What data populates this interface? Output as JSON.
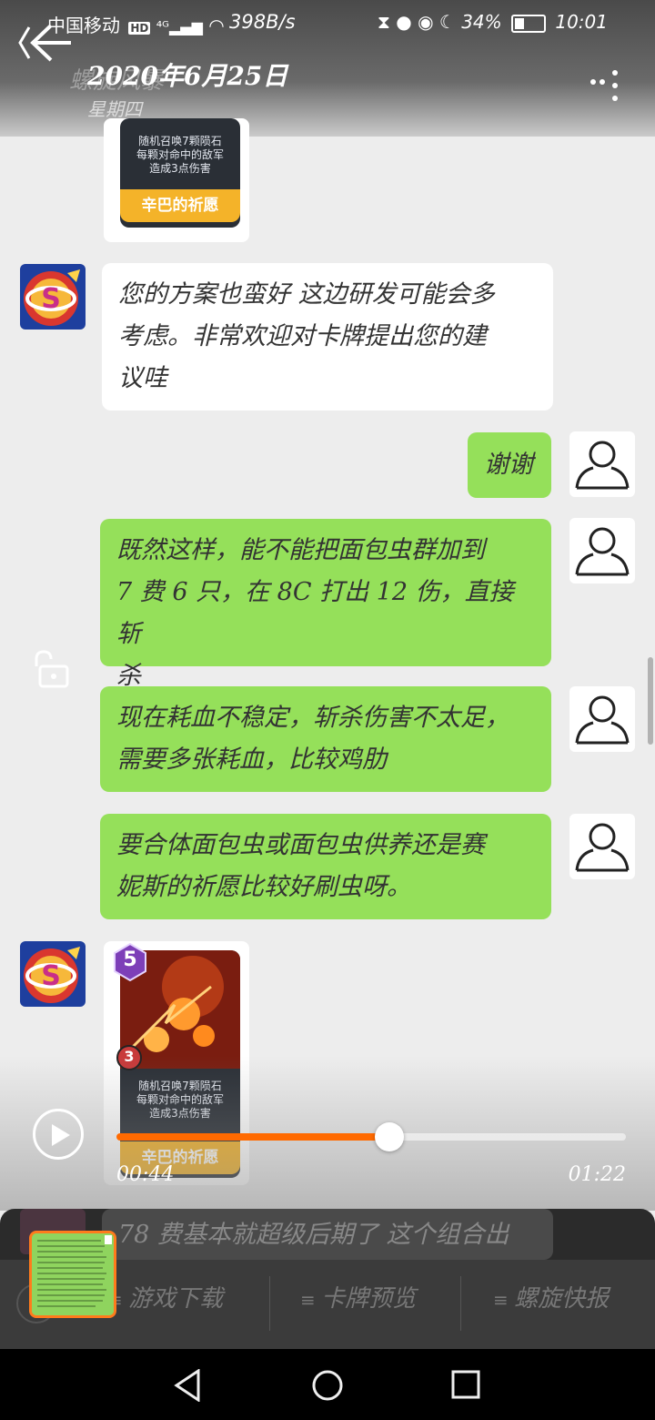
{
  "status_bar": {
    "carrier": "中国移动",
    "hd_badge": "HD",
    "net_speed": "398B/s",
    "battery": "34%",
    "time": "10:01"
  },
  "header": {
    "title": "2020年6月25日",
    "title_faded": "螺旋风暴",
    "subtitle": "星期四"
  },
  "card": {
    "cost": "5",
    "attack": "3",
    "description_lines": [
      "随机召唤7颗陨石",
      "每颗对命中的敌军",
      "造成3点伤害"
    ],
    "name": "辛巴的祈愿"
  },
  "messages": [
    {
      "side": "left",
      "text_lines": [
        "您的方案也蛮好 这边研发可能会多",
        "考虑。非常欢迎对卡牌提出您的建",
        "议哇"
      ]
    },
    {
      "side": "right",
      "text_lines": [
        "谢谢"
      ]
    },
    {
      "side": "right",
      "text_lines": [
        "既然这样，能不能把面包虫群加到",
        "7 费 6 只，在 8C 打出 12 伤，直接斩",
        "杀"
      ]
    },
    {
      "side": "right",
      "text_lines": [
        "现在耗血不稳定，斩杀伤害不太足，",
        "需要多张耗血，比较鸡肋"
      ]
    },
    {
      "side": "right",
      "text_lines": [
        "要合体面包虫或面包虫供养还是赛",
        "妮斯的祈愿比较好刷虫呀。"
      ]
    },
    {
      "side": "left",
      "text_lines": [
        "78 费基本就超级后期了 这个组合出"
      ]
    }
  ],
  "player": {
    "elapsed": "00:44",
    "total": "01:22",
    "progress": 0.536
  },
  "bottom_menu": {
    "items": [
      "游戏下载",
      "卡牌预览",
      "螺旋快报"
    ]
  },
  "colors": {
    "accent": "#ff6a00",
    "bubble_green": "#95e05a",
    "bubble_white": "#ffffff",
    "background": "#ededed"
  }
}
